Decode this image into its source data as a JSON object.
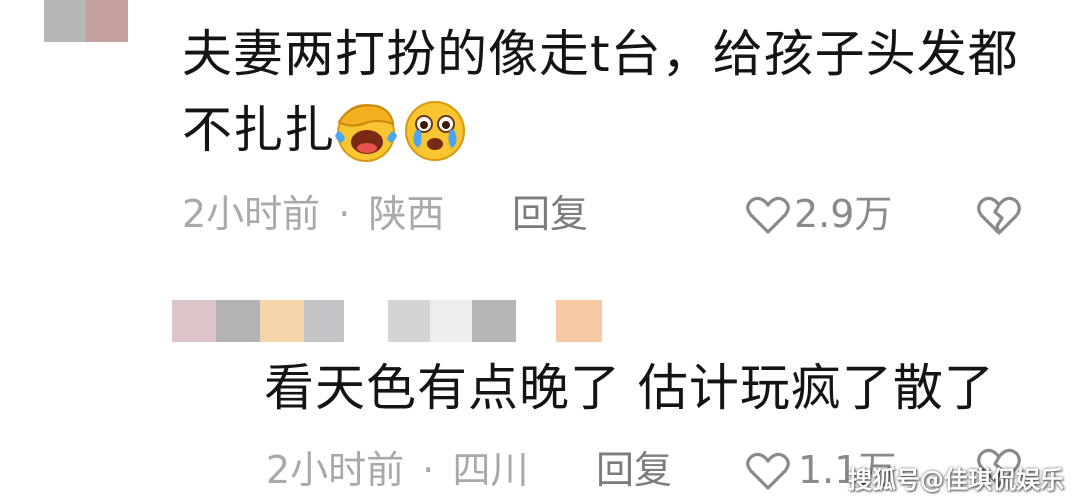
{
  "comments": [
    {
      "text_line1": "夫妻两打扮的像走t台，给孩子头发都",
      "text_line2": "不扎扎",
      "emojis": [
        "facepalm-laughing-emoji",
        "crying-emoji"
      ],
      "time": "2小时前",
      "separator": "·",
      "location": "陕西",
      "reply_label": "回复",
      "like_count": "2.9万",
      "like_icon": "heart-outline-icon",
      "dislike_icon": "broken-heart-icon"
    },
    {
      "text_line1": "看天色有点晚了 估计玩疯了散了",
      "time": "2小时前",
      "separator": "·",
      "location": "四川",
      "reply_label": "回复",
      "like_count": "1.1万",
      "like_icon": "heart-outline-icon",
      "dislike_icon": "broken-heart-icon"
    }
  ],
  "watermark": "搜狐号@佳琪侃娱乐",
  "colors": {
    "text": "#141414",
    "meta": "#a9a9a9",
    "reply": "#7c7c7c",
    "background": "#ffffff"
  }
}
